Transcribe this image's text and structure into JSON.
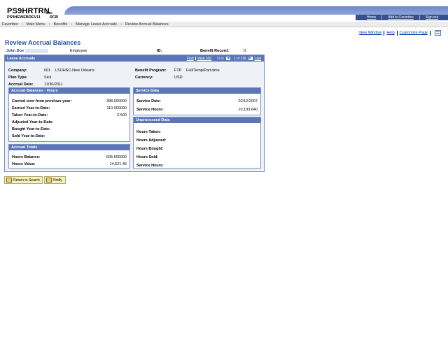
{
  "header": {
    "app_name": "PS9HRTRN",
    "version": "8.50",
    "database": "PS9HEWEBDEV11",
    "user": "RCB",
    "links": [
      "Home",
      "Add to Favorites",
      "Sign out"
    ]
  },
  "breadcrumb": [
    "Favorites",
    "Main Menu",
    "Benefits",
    "Manage Leave Accruals",
    "Review Accrual Balances"
  ],
  "page_links": [
    "New Window",
    "Help",
    "Customize Page"
  ],
  "page_title": "Review Accrual Balances",
  "employee": {
    "name": "John Doe",
    "type": "Employee",
    "id_label": "ID:",
    "record_label": "Benefit Record:",
    "record_value": "0"
  },
  "panel": {
    "title": "Leave Accruals",
    "nav": {
      "find": "Find",
      "view": "View 100",
      "first": "First",
      "range": "1 of 116",
      "last": "Last"
    },
    "fields": {
      "company_label": "Company:",
      "company_code": "001",
      "company_name": "LSUHSC-New Orleans",
      "plan_label": "Plan Type:",
      "plan_value": "Sick",
      "accrual_label": "Accrual Date:",
      "accrual_value": "11/30/2011",
      "benefit_label": "Benefit Program:",
      "benefit_code": "FTP",
      "benefit_desc": "Full/Temp/Part-time",
      "currency_label": "Currency:",
      "currency_value": "USD"
    }
  },
  "accrual_balances": {
    "title": "Accrual Balances - Hours",
    "rows": [
      {
        "label": "Carried over from previous year:",
        "value": "398.000000"
      },
      {
        "label": "Earned Year-to-Date:",
        "value": "110.000000"
      },
      {
        "label": "Taken Year-to-Date:",
        "value": "2.500"
      },
      {
        "label": "Adjusted Year-to-Date:",
        "value": ""
      },
      {
        "label": "Bought Year-to-Date:",
        "value": ""
      },
      {
        "label": "Sold Year-to-Date:",
        "value": ""
      }
    ]
  },
  "accrual_totals": {
    "title": "Accrual Totals",
    "rows": [
      {
        "label": "Hours Balance:",
        "value": "505.500000"
      },
      {
        "label": "Hours Value:",
        "value": "14,621.45"
      }
    ]
  },
  "service_data": {
    "title": "Service Data",
    "rows": [
      {
        "label": "Service Date:",
        "value": "02/12/2007"
      },
      {
        "label": "Service Hours:",
        "value": "10,193.640"
      }
    ]
  },
  "unprocessed_data": {
    "title": "Unprocessed Data",
    "rows": [
      {
        "label": "Hours Taken:",
        "value": ""
      },
      {
        "label": "Hours Adjusted:",
        "value": ""
      },
      {
        "label": "Hours Bought:",
        "value": ""
      },
      {
        "label": "Hours Sold:",
        "value": ""
      },
      {
        "label": "Service Hours:",
        "value": ""
      }
    ]
  },
  "buttons": {
    "return_label": "Return to Search",
    "notify_label": "Notify"
  },
  "colors": {
    "header_band": "#6d88c8",
    "header_bar": "#35518f",
    "panel_header": "#5a76b8",
    "title_text": "#2952a3"
  }
}
